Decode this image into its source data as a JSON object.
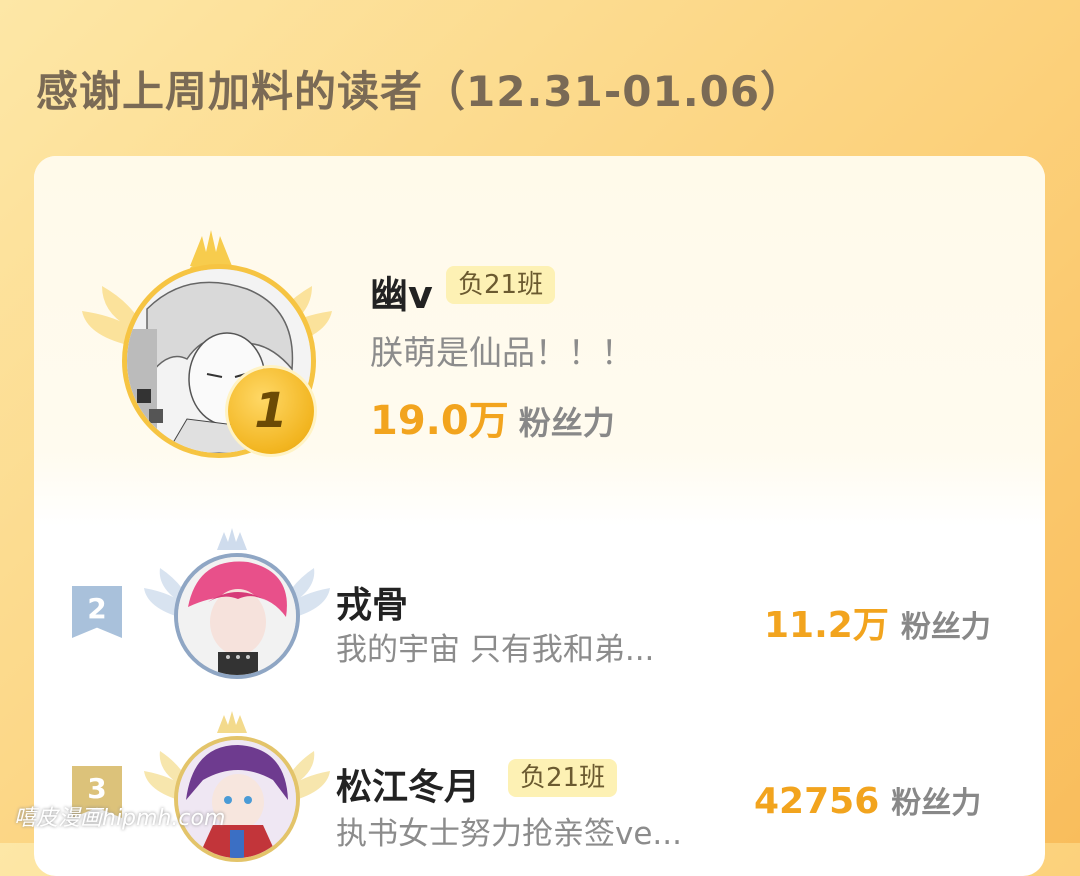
{
  "header": {
    "title": "感谢上周加料的读者（12.31-01.06）"
  },
  "first": {
    "rank": "1",
    "name": "幽v",
    "tag": "负21班",
    "motto": "朕萌是仙品！！！",
    "fans_value": "19.0万",
    "fans_label": "粉丝力"
  },
  "rows": [
    {
      "rank": "2",
      "name": "戎骨",
      "motto": "我的宇宙 只有我和弟...",
      "fans_value": "11.2万",
      "fans_label": "粉丝力"
    },
    {
      "rank": "3",
      "name": "松江冬月",
      "tag": "负21班",
      "motto": "执书女士努力抢亲签ve...",
      "fans_value": "42756",
      "fans_label": "粉丝力"
    }
  ],
  "watermark": "嘻皮漫画hipmh.com",
  "colors": {
    "gold": "#f2a41e",
    "rank2": "#a9c1db",
    "rank3": "#dcc27a",
    "tag_bg": "#fdf1b4"
  }
}
